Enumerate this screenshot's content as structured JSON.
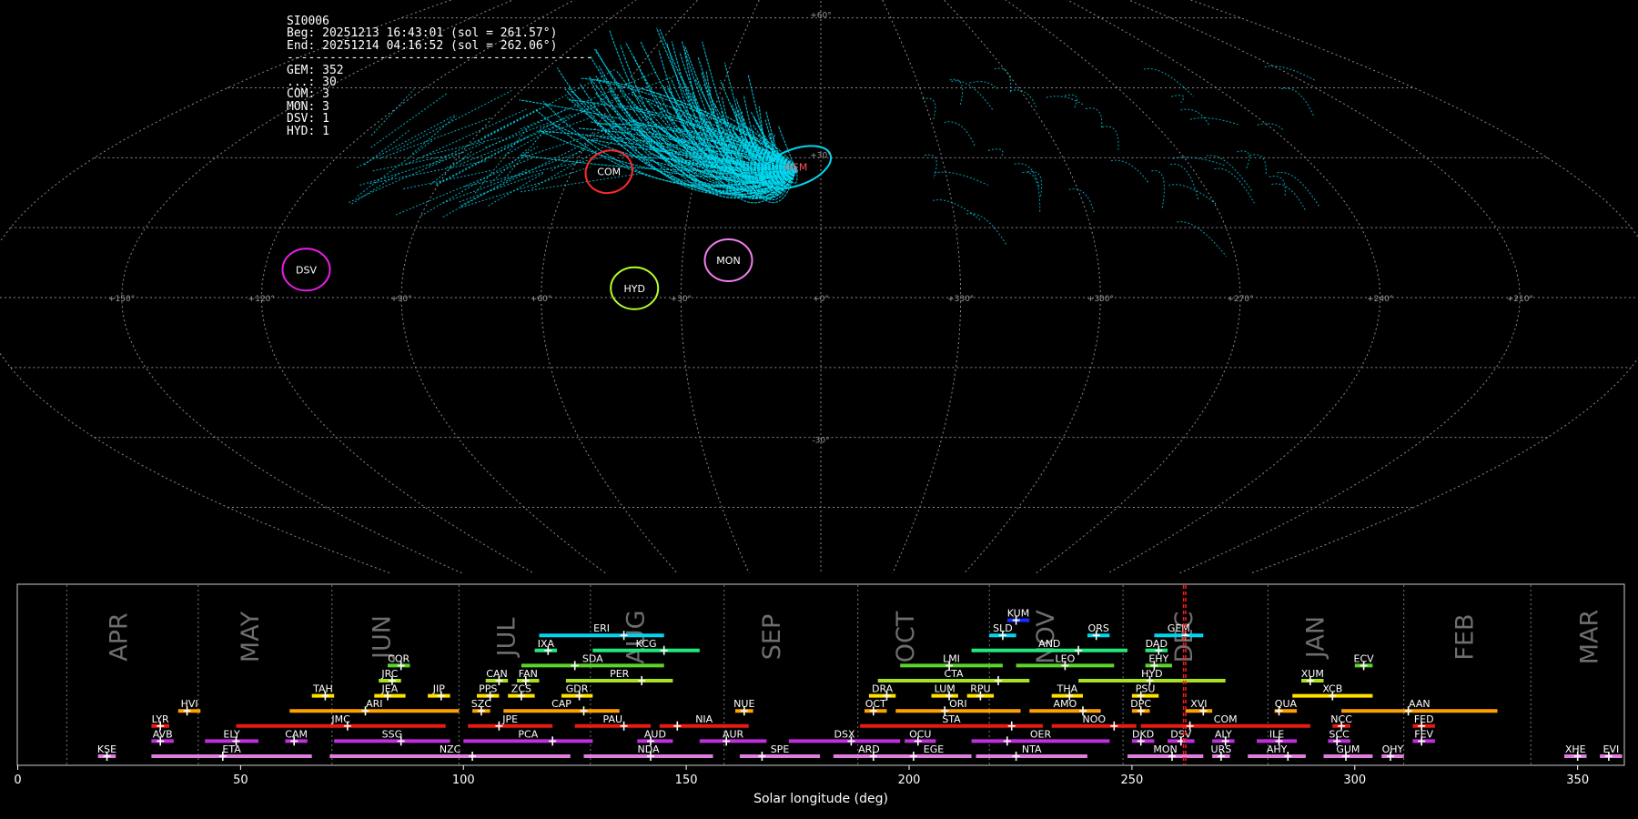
{
  "info": {
    "station": "SI0006",
    "begin": "Beg: 20251213 16:43:01 (sol = 261.57°)",
    "end": "End: 20251214 04:16:52 (sol = 262.06°)",
    "separator": "-------------------------------------------",
    "counts": [
      {
        "label": "GEM",
        "value": 352
      },
      {
        "label": "...",
        "value": 30
      },
      {
        "label": "COM",
        "value": 3
      },
      {
        "label": "MON",
        "value": 3
      },
      {
        "label": "DSV",
        "value": 1
      },
      {
        "label": "HYD",
        "value": 1
      }
    ]
  },
  "sky_map": {
    "projection": "sinusoidal",
    "lon_tick_labels": [
      "+180°",
      "+150°",
      "+120°",
      "+90°",
      "+60°",
      "+30°",
      "+0°",
      "+330°",
      "+300°",
      "+270°",
      "+240°",
      "+210°",
      "+180°"
    ],
    "lat_tick_labels": [
      "+90°",
      "+60°",
      "+30°",
      "-30°",
      "-60°",
      "-90°"
    ],
    "radiants": [
      {
        "name": "GEM",
        "color": "#00d7ee",
        "label_color": "#ff5555",
        "lon": 96,
        "lat": 28
      },
      {
        "name": "COM",
        "color": "#ff2a2a",
        "label_color": "#ffffff",
        "lon": 141,
        "lat": 27
      },
      {
        "name": "MON",
        "color": "#f07ef0",
        "label_color": "#ffffff",
        "lon": 110,
        "lat": 8
      },
      {
        "name": "HYD",
        "color": "#b4ff2a",
        "label_color": "#ffffff",
        "lon": 130,
        "lat": 2
      },
      {
        "name": "DSV",
        "color": "#e81ee8",
        "label_color": "#ffffff",
        "lon": 201,
        "lat": 6
      }
    ]
  },
  "chart_data": {
    "type": "timeline",
    "xlabel": "Solar longitude (deg)",
    "xlim": [
      0,
      365
    ],
    "x_ticks": [
      0,
      50,
      100,
      150,
      200,
      250,
      300,
      350
    ],
    "month_boundaries": [
      11,
      40.5,
      70.5,
      99,
      128.5,
      158.5,
      188.5,
      218,
      248,
      280.5,
      311,
      339.5
    ],
    "months": [
      {
        "name": "APR",
        "sl": 24.5
      },
      {
        "name": "MAY",
        "sl": 54
      },
      {
        "name": "JUN",
        "sl": 83.5
      },
      {
        "name": "JUL",
        "sl": 111.5
      },
      {
        "name": "AUG",
        "sl": 140.5
      },
      {
        "name": "SEP",
        "sl": 171
      },
      {
        "name": "OCT",
        "sl": 201
      },
      {
        "name": "NOV",
        "sl": 232.5
      },
      {
        "name": "DEC",
        "sl": 263.5
      },
      {
        "name": "JAN",
        "sl": 293
      },
      {
        "name": "FEB",
        "sl": 326.5
      },
      {
        "name": "MAR",
        "sl": 354.5
      }
    ],
    "current_sol": [
      261.57,
      262.06
    ],
    "showers": [
      {
        "name": "KUM",
        "start": 222,
        "end": 227,
        "peak": 224,
        "row": 10,
        "color": "#1a2cff"
      },
      {
        "name": "ERI",
        "start": 117,
        "end": 145,
        "peak": 136,
        "row": 9,
        "color": "#00d7ee"
      },
      {
        "name": "SLD",
        "start": 218,
        "end": 224,
        "peak": 221,
        "row": 9,
        "color": "#00d7ee"
      },
      {
        "name": "ORS",
        "start": 240,
        "end": 245,
        "peak": 242,
        "row": 9,
        "color": "#00d7ee"
      },
      {
        "name": "GEM",
        "start": 255,
        "end": 266,
        "peak": 262,
        "row": 9,
        "color": "#00d7ee"
      },
      {
        "name": "IXA",
        "start": 116,
        "end": 121,
        "peak": 119,
        "row": 8,
        "color": "#22e87a"
      },
      {
        "name": "KCG",
        "start": 129,
        "end": 153,
        "peak": 145,
        "row": 8,
        "color": "#22e87a"
      },
      {
        "name": "AND",
        "start": 214,
        "end": 249,
        "peak": 238,
        "row": 8,
        "color": "#22e87a"
      },
      {
        "name": "DAD",
        "start": 253,
        "end": 258,
        "peak": 256,
        "row": 8,
        "color": "#22e87a"
      },
      {
        "name": "COR",
        "start": 83,
        "end": 88,
        "peak": 86,
        "row": 7,
        "color": "#5ad62a"
      },
      {
        "name": "SDA",
        "start": 113,
        "end": 145,
        "peak": 125,
        "row": 7,
        "color": "#5ad62a"
      },
      {
        "name": "LMI",
        "start": 198,
        "end": 221,
        "peak": 209,
        "row": 7,
        "color": "#5ad62a"
      },
      {
        "name": "LEO",
        "start": 224,
        "end": 246,
        "peak": 235,
        "row": 7,
        "color": "#5ad62a"
      },
      {
        "name": "EHY",
        "start": 253,
        "end": 259,
        "peak": 255,
        "row": 7,
        "color": "#5ad62a"
      },
      {
        "name": "ECV",
        "start": 300,
        "end": 304,
        "peak": 302,
        "row": 7,
        "color": "#5ad62a"
      },
      {
        "name": "JRC",
        "start": 81,
        "end": 86,
        "peak": 84,
        "row": 6,
        "color": "#a8e022"
      },
      {
        "name": "CAN",
        "start": 105,
        "end": 110,
        "peak": 108,
        "row": 6,
        "color": "#a8e022"
      },
      {
        "name": "FAN",
        "start": 112,
        "end": 117,
        "peak": 114,
        "row": 6,
        "color": "#a8e022"
      },
      {
        "name": "PER",
        "start": 123,
        "end": 147,
        "peak": 140,
        "row": 6,
        "color": "#a8e022"
      },
      {
        "name": "CTA",
        "start": 193,
        "end": 227,
        "peak": 220,
        "row": 6,
        "color": "#a8e022"
      },
      {
        "name": "HYD",
        "start": 238,
        "end": 271,
        "peak": 254,
        "row": 6,
        "color": "#a8e022"
      },
      {
        "name": "XUM",
        "start": 288,
        "end": 293,
        "peak": 290,
        "row": 6,
        "color": "#a8e022"
      },
      {
        "name": "TAH",
        "start": 66,
        "end": 71,
        "peak": 69,
        "row": 5,
        "color": "#ffe100"
      },
      {
        "name": "JEA",
        "start": 80,
        "end": 87,
        "peak": 83,
        "row": 5,
        "color": "#ffe100"
      },
      {
        "name": "JIP",
        "start": 92,
        "end": 97,
        "peak": 95,
        "row": 5,
        "color": "#ffe100"
      },
      {
        "name": "PPS",
        "start": 103,
        "end": 108,
        "peak": 106,
        "row": 5,
        "color": "#ffe100"
      },
      {
        "name": "ZCS",
        "start": 110,
        "end": 116,
        "peak": 113,
        "row": 5,
        "color": "#ffe100"
      },
      {
        "name": "GDR",
        "start": 122,
        "end": 129,
        "peak": 126,
        "row": 5,
        "color": "#ffe100"
      },
      {
        "name": "DRA",
        "start": 191,
        "end": 197,
        "peak": 195,
        "row": 5,
        "color": "#ffe100"
      },
      {
        "name": "LUM",
        "start": 205,
        "end": 211,
        "peak": 209,
        "row": 5,
        "color": "#ffe100"
      },
      {
        "name": "RPU",
        "start": 213,
        "end": 219,
        "peak": 216,
        "row": 5,
        "color": "#ffe100"
      },
      {
        "name": "THA",
        "start": 232,
        "end": 239,
        "peak": 236,
        "row": 5,
        "color": "#ffe100"
      },
      {
        "name": "PSU",
        "start": 250,
        "end": 256,
        "peak": 252,
        "row": 5,
        "color": "#ffe100"
      },
      {
        "name": "XCB",
        "start": 286,
        "end": 304,
        "peak": 295,
        "row": 5,
        "color": "#ffe100"
      },
      {
        "name": "HVI",
        "start": 36,
        "end": 41,
        "peak": 38,
        "row": 4,
        "color": "#ffa200"
      },
      {
        "name": "ARI",
        "start": 61,
        "end": 99,
        "peak": 78,
        "row": 4,
        "color": "#ffa200"
      },
      {
        "name": "SZC",
        "start": 102,
        "end": 106,
        "peak": 104,
        "row": 4,
        "color": "#ffa200"
      },
      {
        "name": "CAP",
        "start": 109,
        "end": 135,
        "peak": 127,
        "row": 4,
        "color": "#ffa200"
      },
      {
        "name": "NUE",
        "start": 161,
        "end": 165,
        "peak": 163,
        "row": 4,
        "color": "#ffa200"
      },
      {
        "name": "OCT",
        "start": 190,
        "end": 195,
        "peak": 192,
        "row": 4,
        "color": "#ffa200"
      },
      {
        "name": "ORI",
        "start": 197,
        "end": 225,
        "peak": 208,
        "row": 4,
        "color": "#ffa200"
      },
      {
        "name": "AMO",
        "start": 227,
        "end": 243,
        "peak": 239,
        "row": 4,
        "color": "#ffa200"
      },
      {
        "name": "DPC",
        "start": 250,
        "end": 254,
        "peak": 252,
        "row": 4,
        "color": "#ffa200"
      },
      {
        "name": "XVI",
        "start": 262,
        "end": 268,
        "peak": 266,
        "row": 4,
        "color": "#ffa200"
      },
      {
        "name": "QUA",
        "start": 282,
        "end": 287,
        "peak": 283,
        "row": 4,
        "color": "#ffa200"
      },
      {
        "name": "AAN",
        "start": 297,
        "end": 332,
        "peak": 312,
        "row": 4,
        "color": "#ffa200"
      },
      {
        "name": "LYR",
        "start": 30,
        "end": 34,
        "peak": 32,
        "row": 3,
        "color": "#e81b10"
      },
      {
        "name": "JMC",
        "start": 49,
        "end": 96,
        "peak": 74,
        "row": 3,
        "color": "#e81b10"
      },
      {
        "name": "JPE",
        "start": 101,
        "end": 120,
        "peak": 108,
        "row": 3,
        "color": "#e81b10"
      },
      {
        "name": "PAU",
        "start": 125,
        "end": 142,
        "peak": 136,
        "row": 3,
        "color": "#e81b10"
      },
      {
        "name": "NIA",
        "start": 144,
        "end": 164,
        "peak": 148,
        "row": 3,
        "color": "#e81b10"
      },
      {
        "name": "STA",
        "start": 189,
        "end": 230,
        "peak": 223,
        "row": 3,
        "color": "#e81b10"
      },
      {
        "name": "NOO",
        "start": 232,
        "end": 251,
        "peak": 246,
        "row": 3,
        "color": "#e81b10"
      },
      {
        "name": "COM",
        "start": 252,
        "end": 290,
        "peak": 263,
        "row": 3,
        "color": "#e81b10"
      },
      {
        "name": "NCC",
        "start": 295,
        "end": 299,
        "peak": 297,
        "row": 3,
        "color": "#e81b10"
      },
      {
        "name": "FED",
        "start": 313,
        "end": 318,
        "peak": 315,
        "row": 3,
        "color": "#e81b10"
      },
      {
        "name": "AVB",
        "start": 30,
        "end": 35,
        "peak": 32,
        "row": 2,
        "color": "#c22ee0"
      },
      {
        "name": "ELY",
        "start": 42,
        "end": 54,
        "peak": 49,
        "row": 2,
        "color": "#c22ee0"
      },
      {
        "name": "CAM",
        "start": 60,
        "end": 65,
        "peak": 62,
        "row": 2,
        "color": "#c22ee0"
      },
      {
        "name": "SSG",
        "start": 71,
        "end": 97,
        "peak": 86,
        "row": 2,
        "color": "#c22ee0"
      },
      {
        "name": "PCA",
        "start": 100,
        "end": 129,
        "peak": 120,
        "row": 2,
        "color": "#c22ee0"
      },
      {
        "name": "AUD",
        "start": 139,
        "end": 147,
        "peak": 142,
        "row": 2,
        "color": "#c22ee0"
      },
      {
        "name": "AUR",
        "start": 153,
        "end": 168,
        "peak": 159,
        "row": 2,
        "color": "#c22ee0"
      },
      {
        "name": "DSX",
        "start": 173,
        "end": 198,
        "peak": 187,
        "row": 2,
        "color": "#c22ee0"
      },
      {
        "name": "OCU",
        "start": 199,
        "end": 206,
        "peak": 202,
        "row": 2,
        "color": "#c22ee0"
      },
      {
        "name": "OER",
        "start": 214,
        "end": 245,
        "peak": 222,
        "row": 2,
        "color": "#c22ee0"
      },
      {
        "name": "DKD",
        "start": 250,
        "end": 255,
        "peak": 252,
        "row": 2,
        "color": "#c22ee0"
      },
      {
        "name": "DSV",
        "start": 258,
        "end": 264,
        "peak": 261,
        "row": 2,
        "color": "#c22ee0"
      },
      {
        "name": "ALY",
        "start": 268,
        "end": 273,
        "peak": 271,
        "row": 2,
        "color": "#c22ee0"
      },
      {
        "name": "ILE",
        "start": 278,
        "end": 287,
        "peak": 283,
        "row": 2,
        "color": "#c22ee0"
      },
      {
        "name": "SCC",
        "start": 294,
        "end": 299,
        "peak": 296,
        "row": 2,
        "color": "#c22ee0"
      },
      {
        "name": "FEV",
        "start": 313,
        "end": 318,
        "peak": 315,
        "row": 2,
        "color": "#c22ee0"
      },
      {
        "name": "KSE",
        "start": 18,
        "end": 22,
        "peak": 20,
        "row": 1,
        "color": "#e07ee0"
      },
      {
        "name": "ETA",
        "start": 30,
        "end": 66,
        "peak": 46,
        "row": 1,
        "color": "#e07ee0"
      },
      {
        "name": "NZC",
        "start": 70,
        "end": 124,
        "peak": 102,
        "row": 1,
        "color": "#e07ee0"
      },
      {
        "name": "NDA",
        "start": 127,
        "end": 156,
        "peak": 142,
        "row": 1,
        "color": "#e07ee0"
      },
      {
        "name": "SPE",
        "start": 162,
        "end": 180,
        "peak": 167,
        "row": 1,
        "color": "#e07ee0"
      },
      {
        "name": "ARD",
        "start": 183,
        "end": 199,
        "peak": 192,
        "row": 1,
        "color": "#e07ee0"
      },
      {
        "name": "EGE",
        "start": 197,
        "end": 214,
        "peak": 201,
        "row": 1,
        "color": "#e07ee0"
      },
      {
        "name": "NTA",
        "start": 215,
        "end": 240,
        "peak": 224,
        "row": 1,
        "color": "#e07ee0"
      },
      {
        "name": "MON",
        "start": 249,
        "end": 266,
        "peak": 259,
        "row": 1,
        "color": "#e07ee0"
      },
      {
        "name": "URS",
        "start": 268,
        "end": 272,
        "peak": 270,
        "row": 1,
        "color": "#e07ee0"
      },
      {
        "name": "AHY",
        "start": 276,
        "end": 289,
        "peak": 285,
        "row": 1,
        "color": "#e07ee0"
      },
      {
        "name": "GUM",
        "start": 293,
        "end": 304,
        "peak": 298,
        "row": 1,
        "color": "#e07ee0"
      },
      {
        "name": "OHY",
        "start": 306,
        "end": 311,
        "peak": 308,
        "row": 1,
        "color": "#e07ee0"
      },
      {
        "name": "XHE",
        "start": 347,
        "end": 352,
        "peak": 350,
        "row": 1,
        "color": "#e07ee0"
      },
      {
        "name": "EVI",
        "start": 355,
        "end": 360,
        "peak": 357,
        "row": 1,
        "color": "#e07ee0"
      }
    ]
  }
}
